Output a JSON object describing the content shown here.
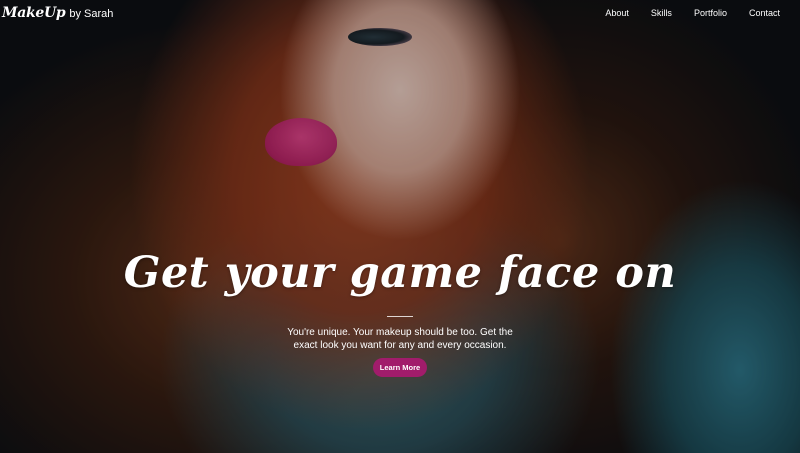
{
  "brand": {
    "script_name": "MakeUp",
    "byline": "by Sarah"
  },
  "nav": {
    "items": [
      {
        "label": "About"
      },
      {
        "label": "Skills"
      },
      {
        "label": "Portfolio"
      },
      {
        "label": "Contact"
      }
    ]
  },
  "hero": {
    "headline": "Get your game face on",
    "subtext": "You're unique. Your makeup should be too. Get the exact look you want for any and every occasion.",
    "cta_label": "Learn More"
  },
  "colors": {
    "accent": "#a11c6b",
    "text": "#ffffff"
  }
}
